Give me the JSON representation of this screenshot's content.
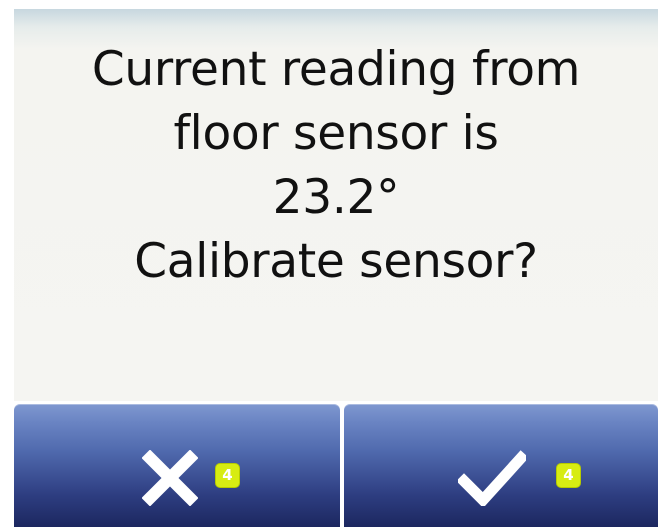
{
  "dialog": {
    "message_lines": [
      "Current reading from",
      "floor sensor is",
      "23.2°",
      "Calibrate sensor?"
    ]
  },
  "buttons": {
    "cancel": {
      "icon": "close-icon",
      "badge": "4"
    },
    "confirm": {
      "icon": "checkmark-icon",
      "badge": "4"
    }
  },
  "colors": {
    "button_top": "#7f98d0",
    "button_bottom": "#1c275f",
    "badge": "#d7ec12",
    "panel": "#f5f5f2"
  }
}
